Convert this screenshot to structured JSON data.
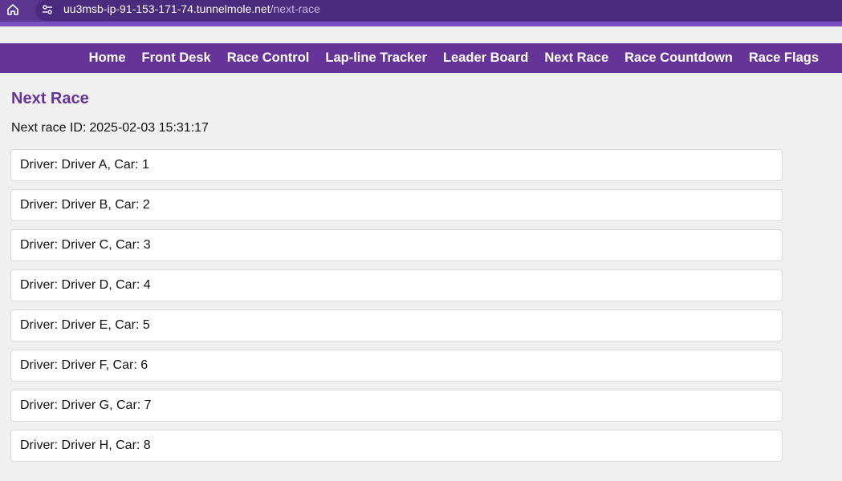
{
  "browser": {
    "url_host": "uu3msb-ip-91-153-171-74.tunnelmole.net",
    "url_path": "/next-race",
    "home_icon": "home-icon",
    "site_info_icon": "site-info-icon"
  },
  "nav": {
    "items": [
      {
        "label": "Home"
      },
      {
        "label": "Front Desk"
      },
      {
        "label": "Race Control"
      },
      {
        "label": "Lap-line Tracker"
      },
      {
        "label": "Leader Board"
      },
      {
        "label": "Next Race"
      },
      {
        "label": "Race Countdown"
      },
      {
        "label": "Race Flags"
      }
    ]
  },
  "page": {
    "title": "Next Race",
    "race_id_label": "Next race ID:",
    "race_id_value": "2025-02-03 15:31:17"
  },
  "drivers": [
    {
      "text": "Driver: Driver A, Car: 1"
    },
    {
      "text": "Driver: Driver B, Car: 2"
    },
    {
      "text": "Driver: Driver C, Car: 3"
    },
    {
      "text": "Driver: Driver D, Car: 4"
    },
    {
      "text": "Driver: Driver E, Car: 5"
    },
    {
      "text": "Driver: Driver F, Car: 6"
    },
    {
      "text": "Driver: Driver G, Car: 7"
    },
    {
      "text": "Driver: Driver H, Car: 8"
    }
  ],
  "colors": {
    "nav_bg": "#663399",
    "title": "#663399",
    "page_bg": "#f0f0f0"
  }
}
